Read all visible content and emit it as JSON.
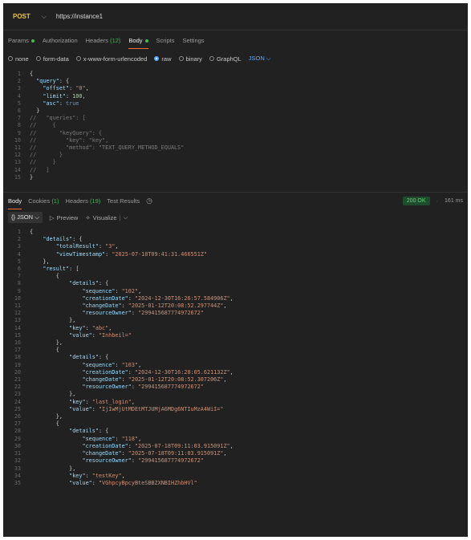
{
  "request": {
    "method": "POST",
    "url": "https://instance1",
    "tabs": [
      {
        "label": "Params",
        "dot": true
      },
      {
        "label": "Authorization"
      },
      {
        "label": "Headers",
        "count": "(12)"
      },
      {
        "label": "Body",
        "dot": true,
        "active": true
      },
      {
        "label": "Scripts"
      },
      {
        "label": "Settings"
      }
    ],
    "body_types": [
      {
        "label": "none"
      },
      {
        "label": "form-data"
      },
      {
        "label": "x-www-form-urlencoded"
      },
      {
        "label": "raw",
        "selected": true
      },
      {
        "label": "binary"
      },
      {
        "label": "GraphQL"
      }
    ],
    "language": "JSON",
    "body_lines": [
      "{",
      "  \"query\": {",
      "    \"offset\": \"0\",",
      "    \"limit\": 100,",
      "    \"asc\": true",
      "  }",
      "//   \"queries\": [",
      "//     {",
      "//       \"keyQuery\": {",
      "//         \"key\": \"key\",",
      "//         \"method\": \"TEXT_QUERY_METHOD_EQUALS\"",
      "//       }",
      "//     }",
      "//   ]",
      "}"
    ]
  },
  "response": {
    "tabs": [
      {
        "label": "Body",
        "active": true
      },
      {
        "label": "Cookies",
        "count": "(1)"
      },
      {
        "label": "Headers",
        "count": "(19)"
      },
      {
        "label": "Test Results"
      }
    ],
    "history_icon": "history-icon",
    "status": "200 OK",
    "time": "161 ms",
    "format": "{} JSON",
    "preview_label": "Preview",
    "visualize_label": "Visualize",
    "body_lines": [
      "{",
      "    \"details\": {",
      "        \"totalResult\": \"3\",",
      "        \"viewTimestamp\": \"2025-07-18T09:41:31.466551Z\"",
      "    },",
      "    \"result\": [",
      "        {",
      "            \"details\": {",
      "                \"sequence\": \"102\",",
      "                \"creationDate\": \"2024-12-30T16:26:57.584906Z\",",
      "                \"changeDate\": \"2025-01-12T20:08:52.297744Z\",",
      "                \"resourceOwner\": \"299415687774972672\"",
      "            },",
      "            \"key\": \"abc\",",
      "            \"value\": \"Inhbeil=\"",
      "        },",
      "        {",
      "            \"details\": {",
      "                \"sequence\": \"103\",",
      "                \"creationDate\": \"2024-12-30T16:28:05.621132Z\",",
      "                \"changeDate\": \"2025-01-12T20:08:52.307206Z\",",
      "                \"resourceOwner\": \"299415687774972672\"",
      "            },",
      "            \"key\": \"last_login\",",
      "            \"value\": \"IjIwMjUtMDEtMTJUMjA6MDg6NTIuMzA4WiI=\"",
      "        },",
      "        {",
      "            \"details\": {",
      "                \"sequence\": \"118\",",
      "                \"creationDate\": \"2025-07-18T09:11:03.915091Z\",",
      "                \"changeDate\": \"2025-07-18T09:11:03.915091Z\",",
      "                \"resourceOwner\": \"299415687774972672\"",
      "            },",
      "            \"key\": \"testKey\",",
      "            \"value\": \"VGhpcyBpcyBteSBBZXNBIHZhbHVl\""
    ]
  }
}
